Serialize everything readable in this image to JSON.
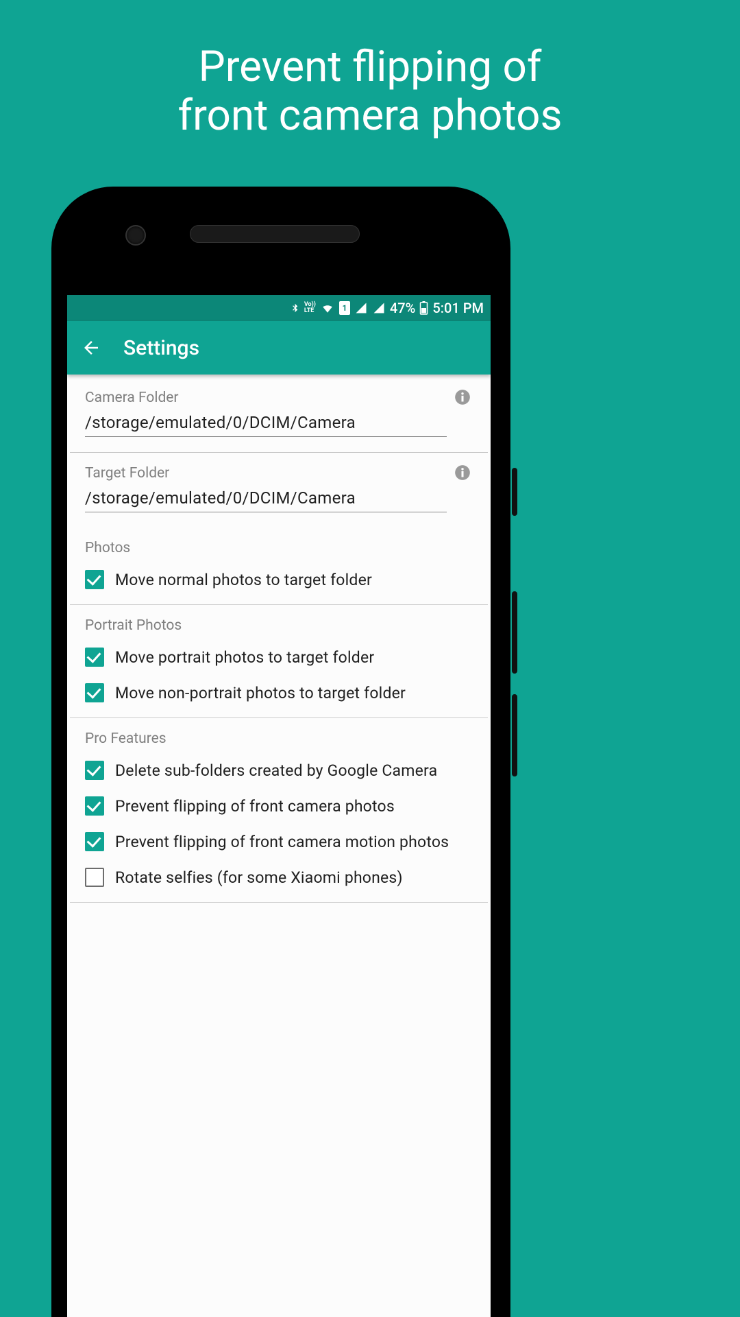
{
  "promo": {
    "line1": "Prevent flipping of",
    "line2": "front camera photos"
  },
  "statusbar": {
    "battery_pct": "47%",
    "time": "5:01 PM",
    "sim_label": "1",
    "volte_label": "Vo))\nLTE"
  },
  "appbar": {
    "title": "Settings"
  },
  "fields": {
    "camera_folder": {
      "label": "Camera Folder",
      "value": "/storage/emulated/0/DCIM/Camera"
    },
    "target_folder": {
      "label": "Target Folder",
      "value": "/storage/emulated/0/DCIM/Camera"
    }
  },
  "sections": {
    "photos": {
      "title": "Photos",
      "items": [
        {
          "label": "Move normal photos to target folder",
          "checked": true
        }
      ]
    },
    "portrait": {
      "title": "Portrait Photos",
      "items": [
        {
          "label": "Move portrait photos to target folder",
          "checked": true
        },
        {
          "label": "Move non-portrait photos to target folder",
          "checked": true
        }
      ]
    },
    "pro": {
      "title": "Pro Features",
      "items": [
        {
          "label": "Delete sub-folders created by Google Camera",
          "checked": true
        },
        {
          "label": "Prevent flipping of front camera photos",
          "checked": true
        },
        {
          "label": "Prevent flipping of front camera motion photos",
          "checked": true
        },
        {
          "label": "Rotate selfies (for some Xiaomi phones)",
          "checked": false
        }
      ]
    }
  }
}
